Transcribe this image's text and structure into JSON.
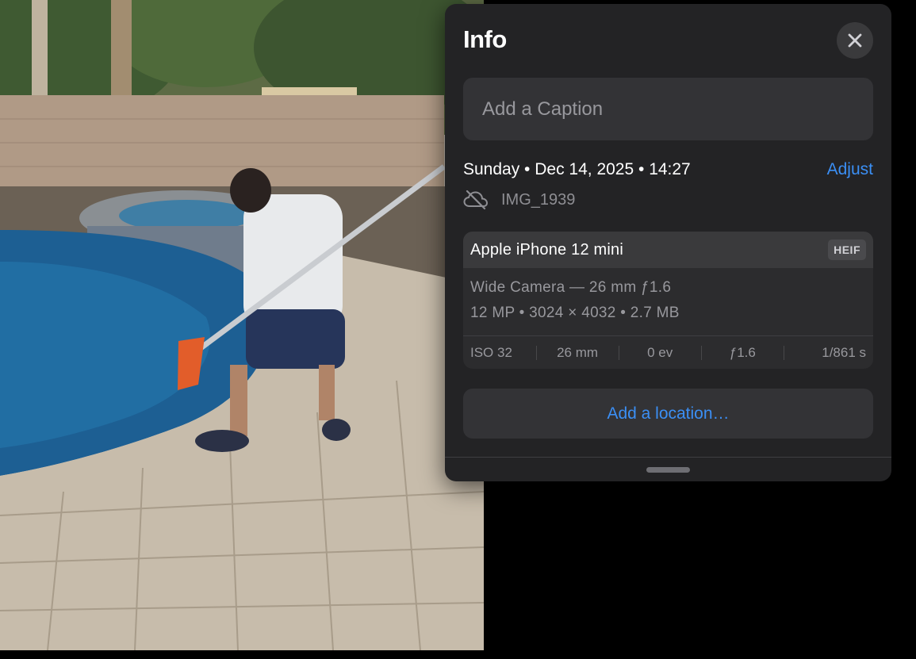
{
  "info_panel": {
    "title": "Info",
    "caption_placeholder": "Add a Caption",
    "datetime": "Sunday • Dec 14, 2025 • 14:27",
    "adjust_label": "Adjust",
    "filename": "IMG_1939",
    "camera": {
      "device": "Apple iPhone 12 mini",
      "format_badge": "HEIF",
      "lens": "Wide Camera — 26 mm ƒ1.6",
      "details": "12 MP • 3024 × 4032 • 2.7 MB",
      "exif": {
        "iso": "ISO 32",
        "focal_length": "26 mm",
        "exposure_bias": "0 ev",
        "aperture": "ƒ1.6",
        "shutter": "1/861 s"
      }
    },
    "location_label": "Add a location…"
  },
  "icons": {
    "close": "close-icon",
    "cloud_off": "cloud-off-icon"
  },
  "colors": {
    "panel_bg": "#232325",
    "accent_blue": "#3b8ff5",
    "secondary_text": "#98989d"
  }
}
